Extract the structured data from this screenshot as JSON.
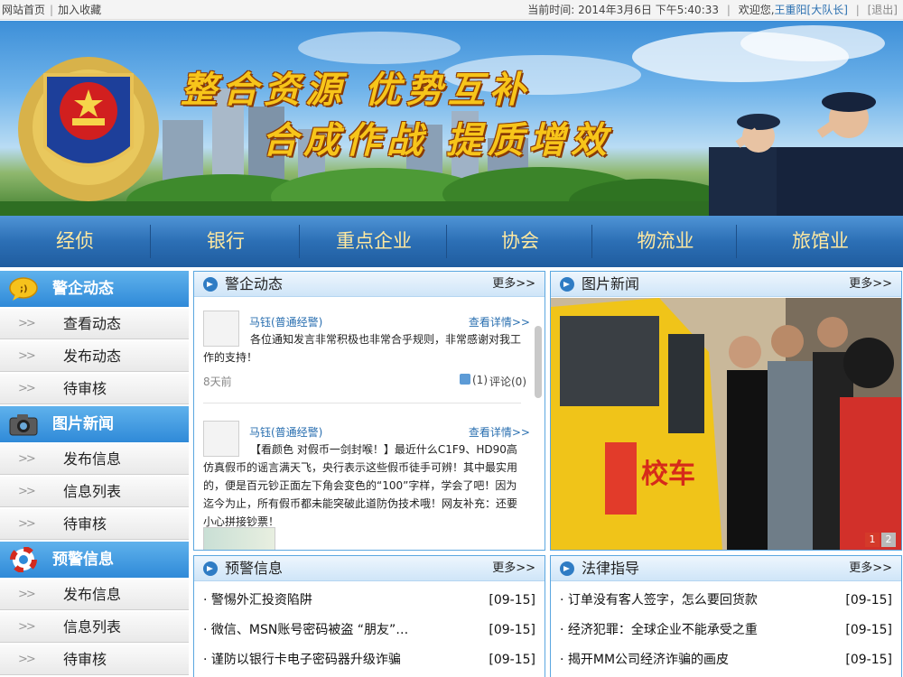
{
  "topbar": {
    "home": "网站首页",
    "favorite": "加入收藏",
    "time_label": "当前时间:",
    "time_value": "2014年3月6日 下午5:40:33",
    "welcome": "欢迎您,",
    "user": "王重阳[大队长]",
    "logout": "[退出]"
  },
  "banner": {
    "slogan1": "整合资源 优势互补",
    "slogan2": "合成作战 提质增效"
  },
  "nav": [
    "经侦",
    "银行",
    "重点企业",
    "协会",
    "物流业",
    "旅馆业"
  ],
  "sidebar": {
    "sections": [
      {
        "title": "警企动态",
        "icon": "chat-bubble-icon",
        "items": [
          "查看动态",
          "发布动态",
          "待审核"
        ]
      },
      {
        "title": "图片新闻",
        "icon": "camera-icon",
        "items": [
          "发布信息",
          "信息列表",
          "待审核"
        ]
      },
      {
        "title": "预警信息",
        "icon": "lifebuoy-icon",
        "items": [
          "发布信息",
          "信息列表",
          "待审核"
        ]
      }
    ],
    "arrow": ">>"
  },
  "panels": {
    "news": {
      "title": "警企动态",
      "more": "更多>>",
      "posts": [
        {
          "author": "马钰(普通经警)",
          "detail": "查看详情>>",
          "body": "各位通知发言非常积极也非常合乎规则，非常感谢对我工作的支持！",
          "time": "8天前",
          "likes": "(1)",
          "comments": "评论(0)"
        },
        {
          "author": "马钰(普通经警)",
          "detail": "查看详情>>",
          "body": "【看颜色 对假币一剑封喉！】最近什么C1F9、HD90高仿真假币的谣言满天飞，央行表示这些假币徒手可辨！其中最实用的，便是百元钞正面左下角会变色的“100”字样，学会了吧！因为迄今为止，所有假币都未能突破此道防伪技术哦！网友补充：还要小心拼接钞票！"
        }
      ]
    },
    "photo": {
      "title": "图片新闻",
      "more": "更多>>",
      "pages": [
        "1",
        "2"
      ],
      "bus_text": "校车"
    },
    "warning": {
      "title": "预警信息",
      "more": "更多>>",
      "rows": [
        {
          "text": "· 警惕外汇投资陷阱",
          "date": "[09-15]"
        },
        {
          "text": "· 微信、MSN账号密码被盗 “朋友”…",
          "date": "[09-15]"
        },
        {
          "text": "· 谨防以银行卡电子密码器升级诈骗",
          "date": "[09-15]"
        }
      ]
    },
    "law": {
      "title": "法律指导",
      "more": "更多>>",
      "rows": [
        {
          "text": "· 订单没有客人签字，怎么要回货款",
          "date": "[09-15]"
        },
        {
          "text": "· 经济犯罪：全球企业不能承受之重",
          "date": "[09-15]"
        },
        {
          "text": "· 揭开MM公司经济诈骗的画皮",
          "date": "[09-15]"
        }
      ]
    }
  }
}
